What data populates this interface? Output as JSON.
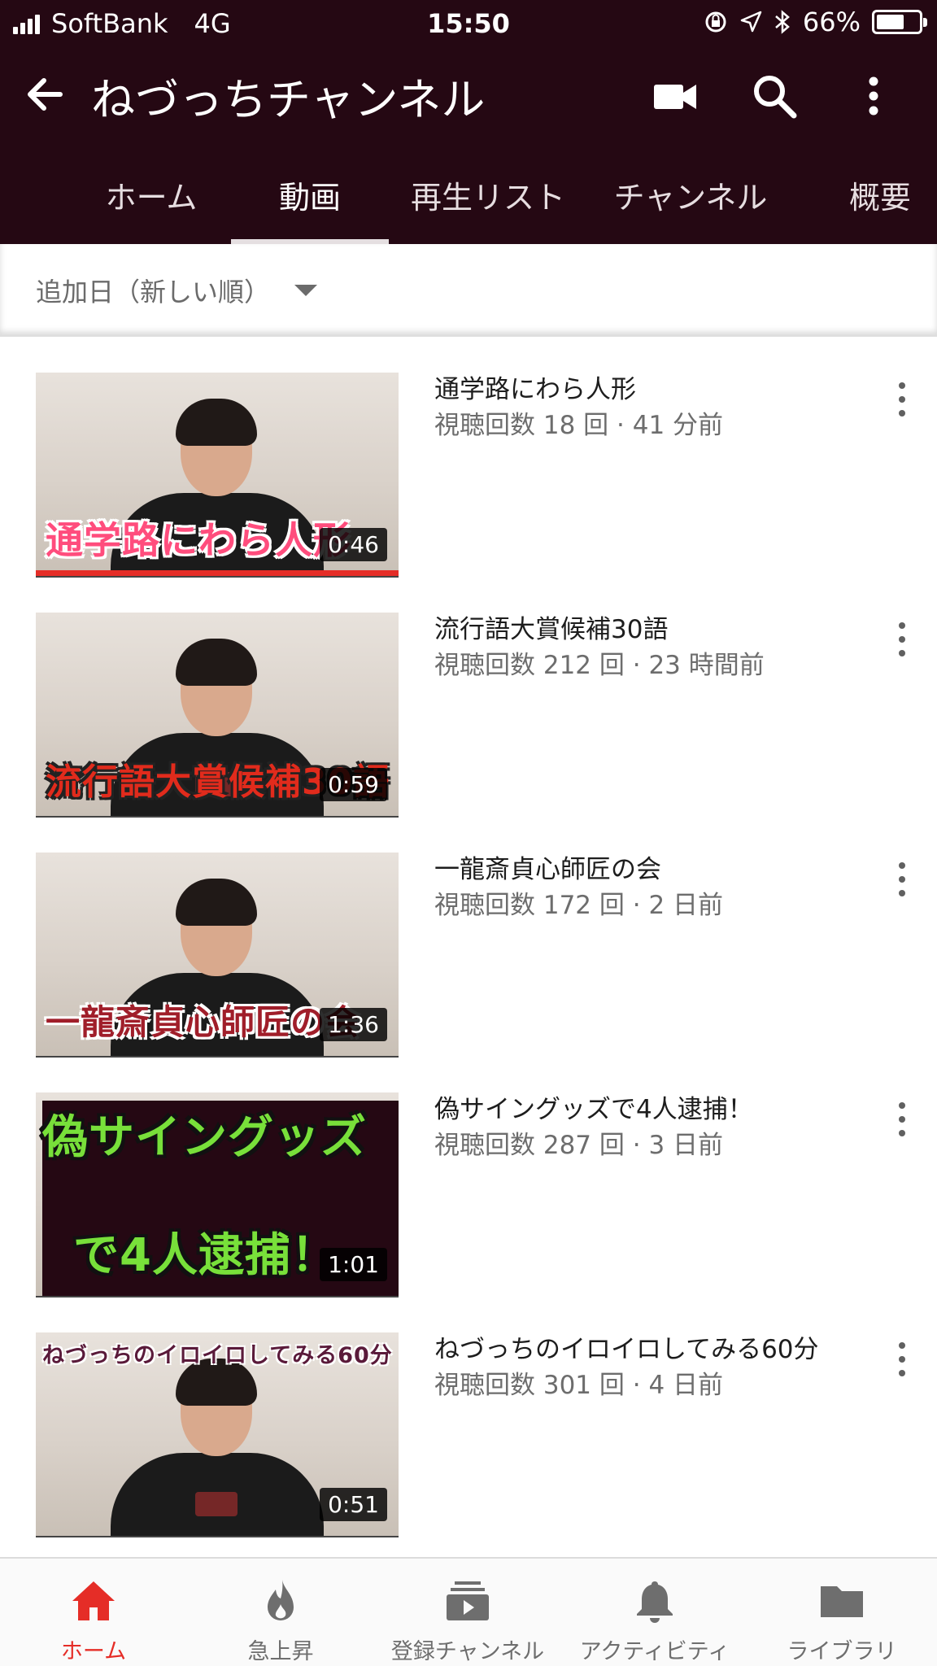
{
  "status_bar": {
    "carrier": "SoftBank",
    "network": "4G",
    "time": "15:50",
    "battery_percent": "66%",
    "battery_level": 0.66
  },
  "app_bar": {
    "channel_title": "ねづっちチャンネル",
    "icons": [
      "back-arrow-icon",
      "video-camera-icon",
      "search-icon",
      "more-vert-icon"
    ]
  },
  "tabs": [
    {
      "label": "ホーム",
      "active": false
    },
    {
      "label": "動画",
      "active": true
    },
    {
      "label": "再生リスト",
      "active": false
    },
    {
      "label": "チャンネル",
      "active": false
    },
    {
      "label": "概要",
      "active": false
    }
  ],
  "sort": {
    "label": "追加日（新しい順）"
  },
  "videos": [
    {
      "title": "通学路にわら人形",
      "meta": "視聴回数 18 回 · 41 分前",
      "duration": "0:46",
      "thumb_caption": "通学路にわら人形",
      "watched_fraction": 1.0
    },
    {
      "title": "流行語大賞候補30語",
      "meta": "視聴回数 212 回 · 23 時間前",
      "duration": "0:59",
      "thumb_caption": "流行語大賞候補30語"
    },
    {
      "title": "一龍斎貞心師匠の会",
      "meta": "視聴回数 172 回 · 2 日前",
      "duration": "1:36",
      "thumb_caption": "一龍斎貞心師匠の会"
    },
    {
      "title": "偽サイングッズで4人逮捕！",
      "meta": "視聴回数 287 回 · 3 日前",
      "duration": "1:01",
      "thumb_caption_top": "偽サイングッズ",
      "thumb_caption_bottom": "で4人逮捕！"
    },
    {
      "title": "ねづっちのイロイロしてみる60分",
      "meta": "視聴回数 301 回 · 4 日前",
      "duration": "0:51",
      "thumb_caption": "ねづっちのイロイロしてみる60分"
    }
  ],
  "bottom_nav": [
    {
      "label": "ホーム",
      "icon": "home-icon",
      "active": true
    },
    {
      "label": "急上昇",
      "icon": "flame-icon",
      "active": false
    },
    {
      "label": "登録チャンネル",
      "icon": "subscriptions-icon",
      "active": false
    },
    {
      "label": "アクティビティ",
      "icon": "bell-icon",
      "active": false
    },
    {
      "label": "ライブラリ",
      "icon": "folder-icon",
      "active": false
    }
  ],
  "colors": {
    "header_bg": "#250813",
    "accent_red": "#e52d27"
  }
}
